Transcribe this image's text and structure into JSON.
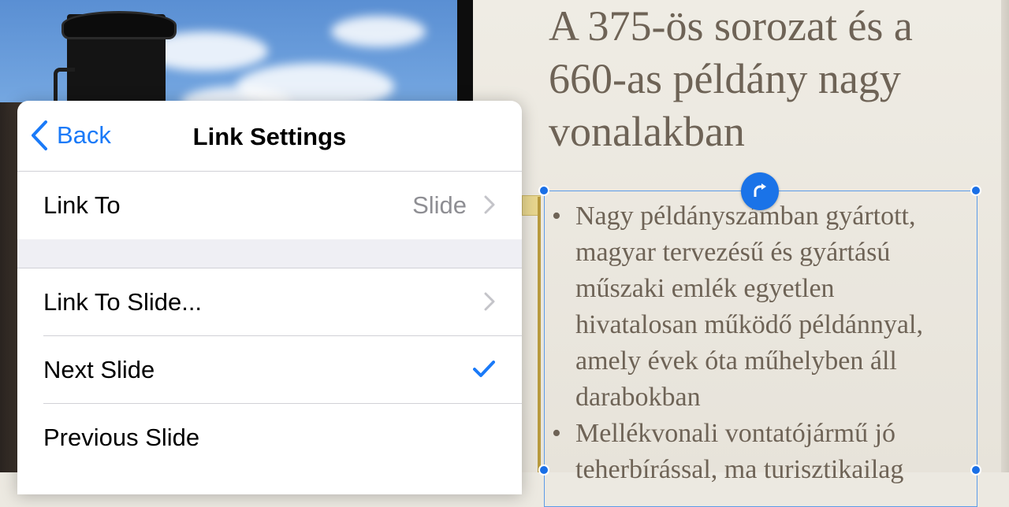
{
  "popover": {
    "back_label": "Back",
    "title": "Link Settings",
    "link_to": {
      "label": "Link To",
      "value": "Slide"
    },
    "options": [
      {
        "label": "Link To Slide...",
        "accessory": "chevron-right-icon"
      },
      {
        "label": "Next Slide",
        "accessory": "checkmark-icon",
        "selected": true
      },
      {
        "label": "Previous Slide",
        "accessory": ""
      }
    ]
  },
  "slide": {
    "title": "A 375-ös sorozat és a 660-as példány nagy vonalakban",
    "bullets": [
      "Nagy példányszámban gyártott, magyar tervezésű és gyártású műszaki emlék egyetlen hivatalosan működő példánnyal, amely évek óta műhelyben áll darabokban",
      "Mellékvonali vontatójármű jó teherbírással, ma turisztikailag"
    ]
  },
  "colors": {
    "accent": "#1a7af8",
    "slide_text": "#6e6356",
    "selection": "#5b9be8"
  }
}
